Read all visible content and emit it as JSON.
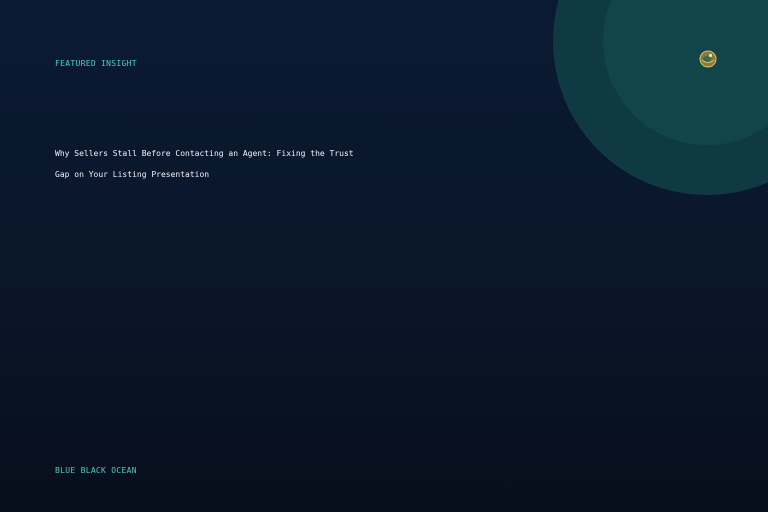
{
  "eyebrow": "FEATURED INSIGHT",
  "headline": "Why Sellers Stall Before Contacting an Agent: Fixing the Trust Gap on Your Listing Presentation",
  "footer_label": "BLUE BLACK OCEAN",
  "badge_icon": "globe-emblem-icon",
  "colors": {
    "accent": "#4ad0bd",
    "background_top": "#0b1a33",
    "background_bottom": "#070e1c",
    "circle_outer": "#0f3a44",
    "circle_inner": "#124549"
  }
}
